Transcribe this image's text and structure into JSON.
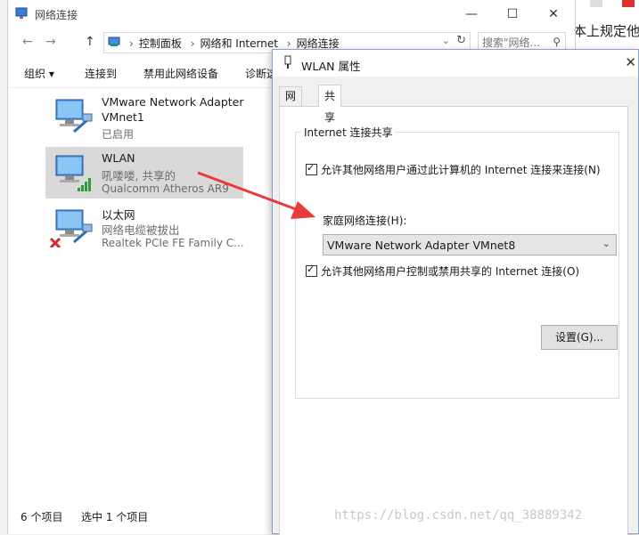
{
  "background_page": {
    "snippet": "本上规定他"
  },
  "explorer": {
    "title": "网络连接",
    "window_controls": {
      "minimize": "—",
      "maximize": "☐",
      "close": "✕"
    },
    "nav": {
      "back": "←",
      "forward": "→",
      "up": "↑"
    },
    "breadcrumb": [
      "控制面板",
      "网络和 Internet",
      "网络连接"
    ],
    "search": {
      "placeholder": "搜索\"网络..."
    },
    "commands": [
      "组织 ▾",
      "连接到",
      "禁用此网络设备",
      "诊断这"
    ],
    "items": [
      {
        "name": "VMware Network Adapter",
        "line2": "VMnet1",
        "line3": "已启用"
      },
      {
        "name": "WLAN",
        "line2": "吼喽喽, 共享的",
        "line3": "Qualcomm Atheros AR9"
      },
      {
        "name": "以太网",
        "line2": "网络电缆被拔出",
        "line3": "Realtek PCIe FE Family C..."
      }
    ],
    "status": {
      "count": "6 个项目",
      "selected": "选中 1 个项目"
    }
  },
  "dialog": {
    "title": "WLAN 属性",
    "close": "✕",
    "tabs": [
      "网络",
      "共享"
    ],
    "group_title": "Internet 连接共享",
    "allow_share_label": "允许其他网络用户通过此计算机的 Internet 连接来连接(N)",
    "home_network_label": "家庭网络连接(H):",
    "home_network_value": "VMware Network Adapter VMnet8",
    "allow_control_label": "允许其他网络用户控制或禁用共享的 Internet 连接(O)",
    "settings_button": "设置(G)..."
  },
  "watermark": "https://blog.csdn.net/qq_38889342",
  "colors": {
    "accent": "#e83a3a",
    "signal_green": "#2e9a3e",
    "selection": "#d9d9d9"
  }
}
